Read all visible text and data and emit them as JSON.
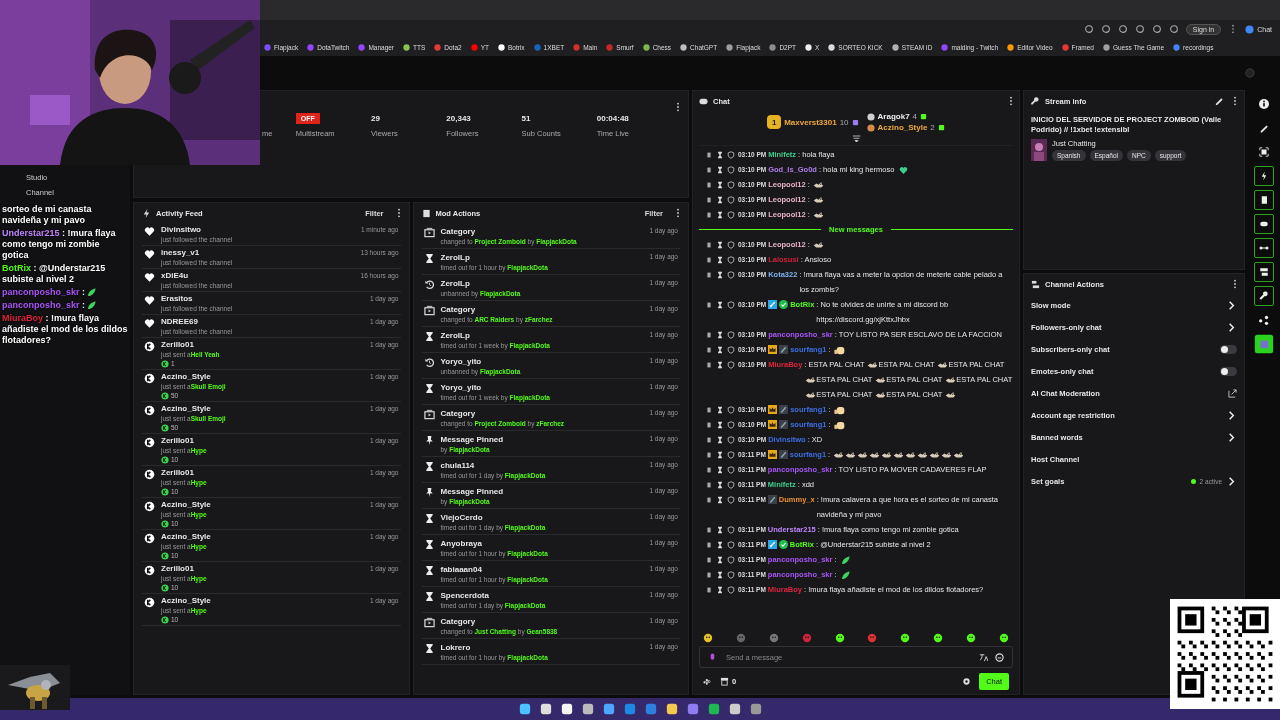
{
  "browser": {
    "sign_in": "Sign in",
    "chat_button": "Chat"
  },
  "bookmarks": [
    {
      "label": "Flapjack",
      "color": "#7c4dff"
    },
    {
      "label": "DotaTwitch",
      "color": "#9146ff"
    },
    {
      "label": "Manager",
      "color": "#9146ff"
    },
    {
      "label": "TTS",
      "color": "#8bc34a"
    },
    {
      "label": "Dota2",
      "color": "#e53935"
    },
    {
      "label": "YT",
      "color": "#ff0000"
    },
    {
      "label": "Botrix",
      "color": "#ffffff"
    },
    {
      "label": "1XBET",
      "color": "#1565c0"
    },
    {
      "label": "Main",
      "color": "#d32f2f"
    },
    {
      "label": "Smurf",
      "color": "#c62828"
    },
    {
      "label": "Chess",
      "color": "#81b64c"
    },
    {
      "label": "ChatGPT",
      "color": "#bdbdbd"
    },
    {
      "label": "Flapjack",
      "color": "#9e9e9e"
    },
    {
      "label": "D2PT",
      "color": "#8d8d8d"
    },
    {
      "label": "X",
      "color": "#eeeeee"
    },
    {
      "label": "SORTEO KICK",
      "color": "#dddddd"
    },
    {
      "label": "STEAM ID",
      "color": "#b0b0b0"
    },
    {
      "label": "malding - Twitch",
      "color": "#9146ff"
    },
    {
      "label": "Editor Video",
      "color": "#ff9800"
    },
    {
      "label": "Framed",
      "color": "#e53935"
    },
    {
      "label": "Guess The Game",
      "color": "#a0a0a0"
    },
    {
      "label": "recordings",
      "color": "#4285f4"
    }
  ],
  "sidebar": {
    "items": [
      {
        "label": "Studio"
      },
      {
        "label": "Channel"
      }
    ]
  },
  "overlay_chat": [
    {
      "text": "sorteo de mi canasta navideña y mi pavo"
    },
    {
      "user": "Understar215",
      "color": "#c084fc",
      "text": " : !mura flaya como tengo mi zombie gotica"
    },
    {
      "user": "BotRix",
      "color": "#53fc18",
      "text": " : @Understar215 subiste al nivel 2"
    },
    {
      "user": "panconposho_skr",
      "color": "#a855f7",
      "text": " :",
      "emote": true
    },
    {
      "user": "panconposho_skr",
      "color": "#a855f7",
      "text": " :",
      "emote": true
    },
    {
      "user": "MiuraBoy",
      "color": "#e0243a",
      "text": " : !mura flaya añadiste el mod de los dildos flotadores?"
    }
  ],
  "stats": [
    {
      "kind": "number",
      "label": "me"
    },
    {
      "kind": "badge",
      "value": "OFF",
      "label": "Multistream"
    },
    {
      "kind": "number",
      "value": "29",
      "label": "Viewers"
    },
    {
      "kind": "number",
      "value": "20,343",
      "label": "Followers"
    },
    {
      "kind": "number",
      "value": "51",
      "label": "Sub Counts"
    },
    {
      "kind": "number",
      "value": "00:04:48",
      "label": "Time Live"
    }
  ],
  "activity_feed": {
    "title": "Activity Feed",
    "filter": "Filter",
    "items": [
      {
        "kind": "follow",
        "name": "Divinsitwo",
        "time": "1 minute ago",
        "text": "just followed the channel"
      },
      {
        "kind": "follow",
        "name": "inessy_v1",
        "time": "13 hours ago",
        "text": "just followed the channel"
      },
      {
        "kind": "follow",
        "name": "xDiE4u",
        "time": "16 hours ago",
        "text": "just followed the channel"
      },
      {
        "kind": "follow",
        "name": "Erasitos",
        "time": "1 day ago",
        "text": "just followed the channel"
      },
      {
        "kind": "follow",
        "name": "NDREE69",
        "time": "1 day ago",
        "text": "just followed the channel"
      },
      {
        "kind": "gift",
        "name": "Zerillo01",
        "time": "1 day ago",
        "text": "just sent a",
        "gift": "Hell Yeah",
        "amount": "1"
      },
      {
        "kind": "gift",
        "name": "Aczino_Style",
        "time": "1 day ago",
        "text": "just sent a",
        "gift": "Skull Emoji",
        "amount": "50"
      },
      {
        "kind": "gift",
        "name": "Aczino_Style",
        "time": "1 day ago",
        "text": "just sent a",
        "gift": "Skull Emoji",
        "amount": "50"
      },
      {
        "kind": "gift",
        "name": "Zerillo01",
        "time": "1 day ago",
        "text": "just sent a",
        "gift": "Hype",
        "amount": "10"
      },
      {
        "kind": "gift",
        "name": "Zerillo01",
        "time": "1 day ago",
        "text": "just sent a",
        "gift": "Hype",
        "amount": "10"
      },
      {
        "kind": "gift",
        "name": "Aczino_Style",
        "time": "1 day ago",
        "text": "just sent a",
        "gift": "Hype",
        "amount": "10"
      },
      {
        "kind": "gift",
        "name": "Aczino_Style",
        "time": "1 day ago",
        "text": "just sent a",
        "gift": "Hype",
        "amount": "10"
      },
      {
        "kind": "gift",
        "name": "Zerillo01",
        "time": "1 day ago",
        "text": "just sent a",
        "gift": "Hype",
        "amount": "10"
      },
      {
        "kind": "gift",
        "name": "Aczino_Style",
        "time": "1 day ago",
        "text": "just sent a",
        "gift": "Hype",
        "amount": "10"
      }
    ]
  },
  "mod_actions": {
    "title": "Mod Actions",
    "filter": "Filter",
    "items": [
      {
        "kind": "category",
        "name": "Category",
        "time": "1 day ago",
        "detail": [
          {
            "text": "changed to",
            "hl": false
          },
          {
            "text": "Project Zomboid",
            "hl": true
          },
          {
            "text": "by",
            "hl": false
          },
          {
            "text": "FlapjackDota",
            "hl": true
          }
        ]
      },
      {
        "kind": "timeout",
        "name": "ZeroILp",
        "time": "1 day ago",
        "detail": [
          {
            "text": "timed out for 1 hour by",
            "hl": false
          },
          {
            "text": "FlapjackDota",
            "hl": true
          }
        ]
      },
      {
        "kind": "unban",
        "name": "ZeroILp",
        "time": "1 day ago",
        "detail": [
          {
            "text": "unbanned by",
            "hl": false
          },
          {
            "text": "FlapjackDota",
            "hl": true
          }
        ]
      },
      {
        "kind": "category",
        "name": "Category",
        "time": "1 day ago",
        "detail": [
          {
            "text": "changed to",
            "hl": false
          },
          {
            "text": "ARC Raiders",
            "hl": true
          },
          {
            "text": "by",
            "hl": false
          },
          {
            "text": "zFarchez",
            "hl": true
          }
        ]
      },
      {
        "kind": "timeout",
        "name": "ZeroILp",
        "time": "1 day ago",
        "detail": [
          {
            "text": "timed out for 1 week by",
            "hl": false
          },
          {
            "text": "FlapjackDota",
            "hl": true
          }
        ]
      },
      {
        "kind": "unban",
        "name": "Yoryo_yito",
        "time": "1 day ago",
        "detail": [
          {
            "text": "unbanned by",
            "hl": false
          },
          {
            "text": "FlapjackDota",
            "hl": true
          }
        ]
      },
      {
        "kind": "timeout",
        "name": "Yoryo_yito",
        "time": "1 day ago",
        "detail": [
          {
            "text": "timed out for 1 week by",
            "hl": false
          },
          {
            "text": "FlapjackDota",
            "hl": true
          }
        ]
      },
      {
        "kind": "category",
        "name": "Category",
        "time": "1 day ago",
        "detail": [
          {
            "text": "changed to",
            "hl": false
          },
          {
            "text": "Project Zomboid",
            "hl": true
          },
          {
            "text": "by",
            "hl": false
          },
          {
            "text": "zFarchez",
            "hl": true
          }
        ]
      },
      {
        "kind": "pin",
        "name": "Message Pinned",
        "time": "1 day ago",
        "detail": [
          {
            "text": "by",
            "hl": false
          },
          {
            "text": "FlapjackDota",
            "hl": true
          }
        ]
      },
      {
        "kind": "timeout",
        "name": "chula114",
        "time": "1 day ago",
        "detail": [
          {
            "text": "timed out for 1 day by",
            "hl": false
          },
          {
            "text": "FlapjackDota",
            "hl": true
          }
        ]
      },
      {
        "kind": "pin",
        "name": "Message Pinned",
        "time": "1 day ago",
        "detail": [
          {
            "text": "by",
            "hl": false
          },
          {
            "text": "FlapjackDota",
            "hl": true
          }
        ]
      },
      {
        "kind": "timeout",
        "name": "ViejoCerdo",
        "time": "1 day ago",
        "detail": [
          {
            "text": "timed out for 1 day by",
            "hl": false
          },
          {
            "text": "FlapjackDota",
            "hl": true
          }
        ]
      },
      {
        "kind": "timeout",
        "name": "Anyobraya",
        "time": "1 day ago",
        "detail": [
          {
            "text": "timed out for 1 hour by",
            "hl": false
          },
          {
            "text": "FlapjackDota",
            "hl": true
          }
        ]
      },
      {
        "kind": "timeout",
        "name": "fabiaaan04",
        "time": "1 day ago",
        "detail": [
          {
            "text": "timed out for 1 hour by",
            "hl": false
          },
          {
            "text": "FlapjackDota",
            "hl": true
          }
        ]
      },
      {
        "kind": "timeout",
        "name": "Spencerdota",
        "time": "1 day ago",
        "detail": [
          {
            "text": "timed out for 1 day by",
            "hl": false
          },
          {
            "text": "FlapjackDota",
            "hl": true
          }
        ]
      },
      {
        "kind": "category",
        "name": "Category",
        "time": "1 day ago",
        "detail": [
          {
            "text": "changed to",
            "hl": false
          },
          {
            "text": "Just Chatting",
            "hl": true
          },
          {
            "text": "by",
            "hl": false
          },
          {
            "text": "Gean5838",
            "hl": true
          }
        ]
      },
      {
        "kind": "timeout",
        "name": "Lokrero",
        "time": "1 day ago",
        "detail": [
          {
            "text": "timed out for 1 hour by",
            "hl": false
          },
          {
            "text": "FlapjackDota",
            "hl": true
          }
        ]
      }
    ]
  },
  "chat": {
    "title": "Chat",
    "leaders": [
      {
        "rank": "1",
        "name": "Maxverst3301",
        "count": "10"
      },
      {
        "name": "Aragok7",
        "count": "4"
      },
      {
        "name": "Aczino_Style",
        "count": "2"
      }
    ],
    "messages": [
      {
        "kind": "plain",
        "time": "03:10 PM",
        "user": "Minifetz",
        "color": "#3ecf8e",
        "parts": [
          {
            "kind": "text",
            "text": ": hola flaya"
          }
        ]
      },
      {
        "kind": "plain",
        "time": "03:10 PM",
        "user": "God_Is_Go0d",
        "color": "#b07ce8",
        "parts": [
          {
            "kind": "text",
            "text": ": hola mi king hermoso"
          },
          {
            "kind": "heart"
          }
        ]
      },
      {
        "kind": "plain",
        "time": "03:10 PM",
        "user": "Leopool12",
        "color": "#e8b4c8",
        "parts": [
          {
            "kind": "text",
            "text": ":"
          },
          {
            "kind": "emote"
          }
        ]
      },
      {
        "kind": "plain",
        "time": "03:10 PM",
        "user": "Leopool12",
        "color": "#e8b4c8",
        "parts": [
          {
            "kind": "text",
            "text": ":"
          },
          {
            "kind": "emote"
          }
        ]
      },
      {
        "kind": "plain",
        "time": "03:10 PM",
        "user": "Leopool12",
        "color": "#e8b4c8",
        "parts": [
          {
            "kind": "text",
            "text": ":"
          },
          {
            "kind": "emote"
          }
        ]
      },
      {
        "kind": "divider",
        "text": "New messages"
      },
      {
        "kind": "plain",
        "time": "03:10 PM",
        "user": "Leopool12",
        "color": "#e8b4c8",
        "parts": [
          {
            "kind": "text",
            "text": ":"
          },
          {
            "kind": "emote"
          }
        ]
      },
      {
        "kind": "plain",
        "time": "03:10 PM",
        "user": "Lalosusi",
        "color": "#d0213a",
        "parts": [
          {
            "kind": "text",
            "text": ": Ansioso"
          }
        ]
      },
      {
        "kind": "plain",
        "time": "03:10 PM",
        "user": "Kota322",
        "color": "#7fb2f0",
        "parts": [
          {
            "kind": "text",
            "text": ": !mura flaya vas a meter la opcion de meterle cable pelado a los zombis?"
          }
        ]
      },
      {
        "kind": "bot",
        "time": "03:10 PM",
        "user": "BotRix",
        "color": "#53fc18",
        "parts": [
          {
            "kind": "text",
            "text": ": No te olvides de unirte a mi discord bb https://discord.gg/xjKttxJhbx"
          }
        ]
      },
      {
        "kind": "plain",
        "time": "03:10 PM",
        "user": "panconposho_skr",
        "color": "#a855f7",
        "parts": [
          {
            "kind": "text",
            "text": ": TOY LISTO PA SER ESCLAVO DE LA FACCION"
          }
        ]
      },
      {
        "kind": "founder",
        "time": "03:10 PM",
        "user": "sourfang1",
        "color": "#3b6fe0",
        "parts": [
          {
            "kind": "text",
            "text": ":"
          },
          {
            "kind": "face"
          }
        ]
      },
      {
        "kind": "plain",
        "time": "03:10 PM",
        "user": "MiuraBoy",
        "color": "#e0243a",
        "parts": [
          {
            "kind": "text",
            "text": ": ESTA PAL CHAT"
          },
          {
            "kind": "emote"
          },
          {
            "kind": "text",
            "text": "ESTA PAL CHAT"
          },
          {
            "kind": "emote"
          },
          {
            "kind": "text",
            "text": "ESTA PAL CHAT"
          },
          {
            "kind": "emote"
          },
          {
            "kind": "text",
            "text": "ESTA PAL CHAT"
          },
          {
            "kind": "emote"
          },
          {
            "kind": "text",
            "text": "ESTA PAL CHAT"
          },
          {
            "kind": "emote"
          },
          {
            "kind": "text",
            "text": "ESTA PAL CHAT"
          },
          {
            "kind": "emote"
          },
          {
            "kind": "text",
            "text": "ESTA PAL CHAT"
          },
          {
            "kind": "emote"
          },
          {
            "kind": "text",
            "text": "ESTA PAL CHAT"
          },
          {
            "kind": "emote"
          }
        ]
      },
      {
        "kind": "founder",
        "time": "03:10 PM",
        "user": "sourfang1",
        "color": "#3b6fe0",
        "parts": [
          {
            "kind": "text",
            "text": ":"
          },
          {
            "kind": "face"
          }
        ]
      },
      {
        "kind": "founder",
        "time": "03:10 PM",
        "user": "sourfang1",
        "color": "#3b6fe0",
        "parts": [
          {
            "kind": "text",
            "text": ":"
          },
          {
            "kind": "face"
          }
        ]
      },
      {
        "kind": "plain",
        "time": "03:10 PM",
        "user": "Divinsitwo",
        "color": "#3b6fe0",
        "parts": [
          {
            "kind": "text",
            "text": ": XD"
          }
        ]
      },
      {
        "kind": "founder",
        "time": "03:11 PM",
        "user": "sourfang1",
        "color": "#3b6fe0",
        "parts": [
          {
            "kind": "text",
            "text": ":"
          },
          {
            "kind": "emote"
          },
          {
            "kind": "emote"
          },
          {
            "kind": "emote"
          },
          {
            "kind": "emote"
          },
          {
            "kind": "emote"
          },
          {
            "kind": "emote"
          },
          {
            "kind": "emote"
          },
          {
            "kind": "emote"
          },
          {
            "kind": "emote"
          },
          {
            "kind": "emote"
          },
          {
            "kind": "emote"
          }
        ]
      },
      {
        "kind": "plain",
        "time": "03:11 PM",
        "user": "panconposho_skr",
        "color": "#a855f7",
        "parts": [
          {
            "kind": "text",
            "text": ": TOY LISTO PA MOVER CADAVERES FLAP"
          }
        ]
      },
      {
        "kind": "plain",
        "time": "03:11 PM",
        "user": "Minifetz",
        "color": "#3ecf8e",
        "parts": [
          {
            "kind": "text",
            "text": ": xdd"
          }
        ]
      },
      {
        "kind": "sub",
        "time": "03:11 PM",
        "user": "Dummy_x",
        "color": "#f0932b",
        "parts": [
          {
            "kind": "text",
            "text": ": !mura calavera a que hora es el sorteo de mi canasta navideña y mi pavo"
          }
        ]
      },
      {
        "kind": "plain",
        "time": "03:11 PM",
        "user": "Understar215",
        "color": "#c084fc",
        "parts": [
          {
            "kind": "text",
            "text": ": !mura flaya como tengo mi zombie gotica"
          }
        ]
      },
      {
        "kind": "bot",
        "time": "03:11 PM",
        "user": "BotRix",
        "color": "#53fc18",
        "parts": [
          {
            "kind": "text",
            "text": ": @Understar215 subiste al nivel 2"
          }
        ]
      },
      {
        "kind": "plain",
        "time": "03:11 PM",
        "user": "panconposho_skr",
        "color": "#a855f7",
        "parts": [
          {
            "kind": "text",
            "text": ":"
          },
          {
            "kind": "leaf"
          }
        ]
      },
      {
        "kind": "plain",
        "time": "03:11 PM",
        "user": "panconposho_skr",
        "color": "#a855f7",
        "parts": [
          {
            "kind": "text",
            "text": ":"
          },
          {
            "kind": "leaf"
          }
        ]
      },
      {
        "kind": "plain",
        "time": "03:11 PM",
        "user": "MiuraBoy",
        "color": "#e0243a",
        "parts": [
          {
            "kind": "text",
            "text": ": !mura flaya añadiste el mod de los dildos flotadores?"
          }
        ]
      }
    ],
    "input": {
      "placeholder": "Send a message"
    },
    "points": "0",
    "send": "Chat"
  },
  "stream_info": {
    "title": "Stream info",
    "stream_title": "INICIO DEL SERVIDOR DE PROJECT ZOMBOID (Valle Podrido) // !1xbet !extensibl",
    "category": "Just Chatting",
    "tags": [
      "Spanish",
      "Español",
      "NPC",
      "support"
    ]
  },
  "channel_actions": {
    "title": "Channel Actions",
    "items": [
      {
        "kind": "arrow",
        "label": "Slow mode"
      },
      {
        "kind": "arrow",
        "label": "Followers-only chat"
      },
      {
        "kind": "toggle",
        "label": "Subscribers-only chat",
        "on": false
      },
      {
        "kind": "toggle",
        "label": "Emotes-only chat",
        "on": false
      },
      {
        "kind": "external",
        "label": "AI Chat Moderation"
      },
      {
        "kind": "arrow",
        "label": "Account age restriction"
      },
      {
        "kind": "arrow",
        "label": "Banned words"
      },
      {
        "kind": "plain",
        "label": "Host Channel"
      },
      {
        "kind": "goals",
        "label": "Set goals",
        "note": "2 active"
      }
    ]
  }
}
